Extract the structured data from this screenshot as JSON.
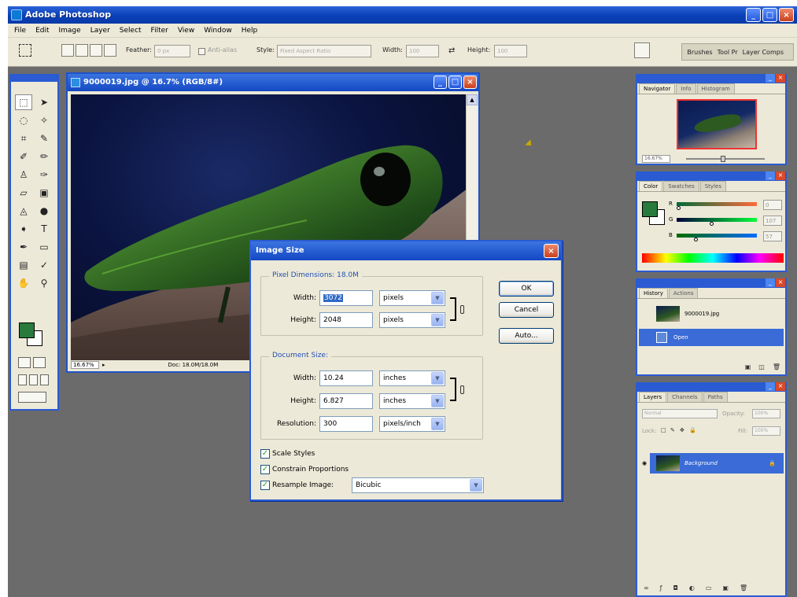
{
  "app": {
    "title": "Adobe Photoshop",
    "window_buttons": [
      "_",
      "□",
      "×"
    ]
  },
  "menubar": {
    "items": [
      "File",
      "Edit",
      "Image",
      "Layer",
      "Select",
      "Filter",
      "View",
      "Window",
      "Help"
    ]
  },
  "options_bar": {
    "feather_label": "Feather:",
    "feather_value": "0 px",
    "antialias_label": "Anti-alias",
    "style_label": "Style:",
    "style_value": "Fixed Aspect Ratio",
    "width_label": "Width:",
    "width_value": "100",
    "height_label": "Height:",
    "height_value": "100",
    "palette_well": [
      "Brushes",
      "Tool Pr",
      "Layer Comps"
    ]
  },
  "document": {
    "title": "9000019.jpg @ 16.7% (RGB/8#)",
    "zoom": "16.67%",
    "doc_size": "Doc: 18.0M/18.0M"
  },
  "dialog": {
    "title": "Image Size",
    "close": "×",
    "pixel_group_label": "Pixel Dimensions: 18.0M",
    "pixel_width_label": "Width:",
    "pixel_width_value": "3072",
    "pixel_width_unit": "pixels",
    "pixel_height_label": "Height:",
    "pixel_height_value": "2048",
    "pixel_height_unit": "pixels",
    "doc_group_label": "Document Size:",
    "doc_width_label": "Width:",
    "doc_width_value": "10.24",
    "doc_width_unit": "inches",
    "doc_height_label": "Height:",
    "doc_height_value": "6.827",
    "doc_height_unit": "inches",
    "resolution_label": "Resolution:",
    "resolution_value": "300",
    "resolution_unit": "pixels/inch",
    "scale_styles_label": "Scale Styles",
    "constrain_label": "Constrain Proportions",
    "resample_label": "Resample Image:",
    "resample_value": "Bicubic",
    "ok_label": "OK",
    "cancel_label": "Cancel",
    "auto_label": "Auto...",
    "checked_mark": "✓"
  },
  "navigator": {
    "tabs": [
      "Navigator",
      "Info",
      "Histogram"
    ],
    "zoom": "16.67%"
  },
  "color_palette": {
    "tabs": [
      "Color",
      "Swatches",
      "Styles"
    ],
    "r_label": "R",
    "r_value": "0",
    "g_label": "G",
    "g_value": "107",
    "b_label": "B",
    "b_value": "57"
  },
  "history": {
    "tabs": [
      "History",
      "Actions"
    ],
    "snapshot_label": "9000019.jpg",
    "step_label": "Open"
  },
  "layers": {
    "tabs": [
      "Layers",
      "Channels",
      "Paths"
    ],
    "blend_mode": "Normal",
    "opacity_label": "Opacity:",
    "opacity_value": "100%",
    "lock_label": "Lock:",
    "fill_label": "Fill:",
    "fill_value": "100%",
    "layer_name": "Background"
  },
  "colors": {
    "title_blue": "#0a3fb7",
    "foreground": "#287a3d",
    "background": "#ffffff",
    "workspace": "#6b6b6b",
    "selection": "#3a6bd6"
  }
}
